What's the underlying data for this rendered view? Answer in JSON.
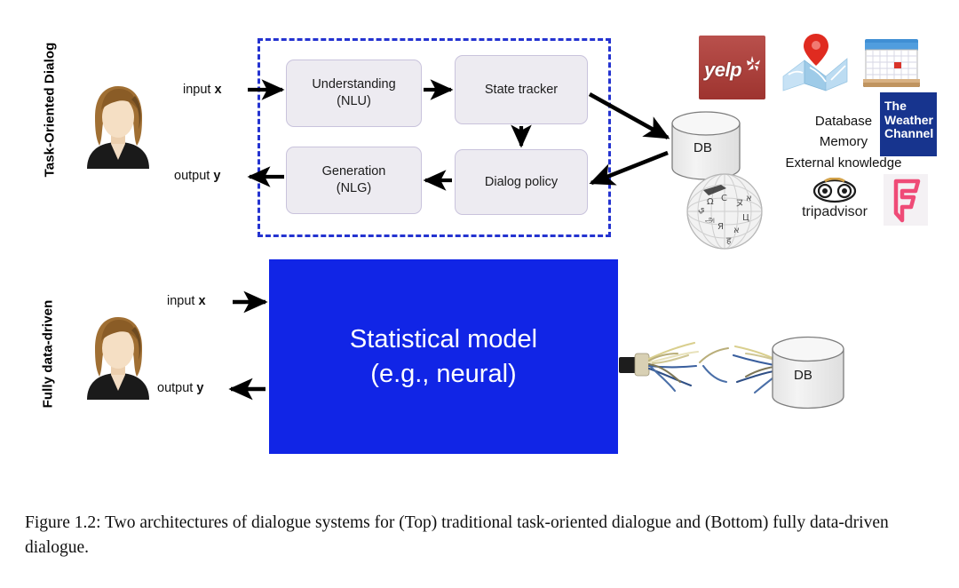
{
  "figure": {
    "rows": [
      {
        "label": "Task-Oriented Dialog"
      },
      {
        "label": "Fully data-driven"
      }
    ],
    "io": {
      "input_prefix": "input ",
      "input_var": "x",
      "output_prefix": "output ",
      "output_var": "y"
    },
    "task_oriented": {
      "modules": [
        {
          "line1": "Understanding",
          "line2": "(NLU)"
        },
        {
          "line1": "State tracker",
          "line2": ""
        },
        {
          "line1": "Dialog policy",
          "line2": ""
        },
        {
          "line1": "Generation",
          "line2": "(NLG)"
        }
      ],
      "database_label": "DB",
      "knowledge_sources": [
        "Database",
        "Memory",
        "External knowledge"
      ],
      "logos": [
        {
          "name": "yelp-logo",
          "text": "yelp"
        },
        {
          "name": "map-logo",
          "text": ""
        },
        {
          "name": "calendar-logo",
          "text": ""
        },
        {
          "name": "weather-channel-logo",
          "line1": "The",
          "line2": "Weather",
          "line3": "Channel"
        },
        {
          "name": "wikipedia-logo",
          "text": ""
        },
        {
          "name": "tripadvisor-logo",
          "text": "tripadvisor"
        },
        {
          "name": "foursquare-logo",
          "text": ""
        }
      ]
    },
    "data_driven": {
      "model_line1": "Statistical model",
      "model_line2": "(e.g., neural)",
      "database_label": "DB"
    },
    "colors": {
      "dashed_border": "#2433d0",
      "model_box": "#1125e6",
      "module_fill": "#edebf1",
      "module_border": "#c9c3dc",
      "arrow": "#000000",
      "yelp_red": "#9e342f",
      "weather_blue": "#17348e",
      "foursquare_pink": "#ef4b77"
    }
  },
  "caption": {
    "line1": "Figure 1.2: Two architectures of dialogue systems for (Top) traditional task-oriented dialogue and",
    "line2": "(Bottom) fully data-driven dialogue."
  }
}
